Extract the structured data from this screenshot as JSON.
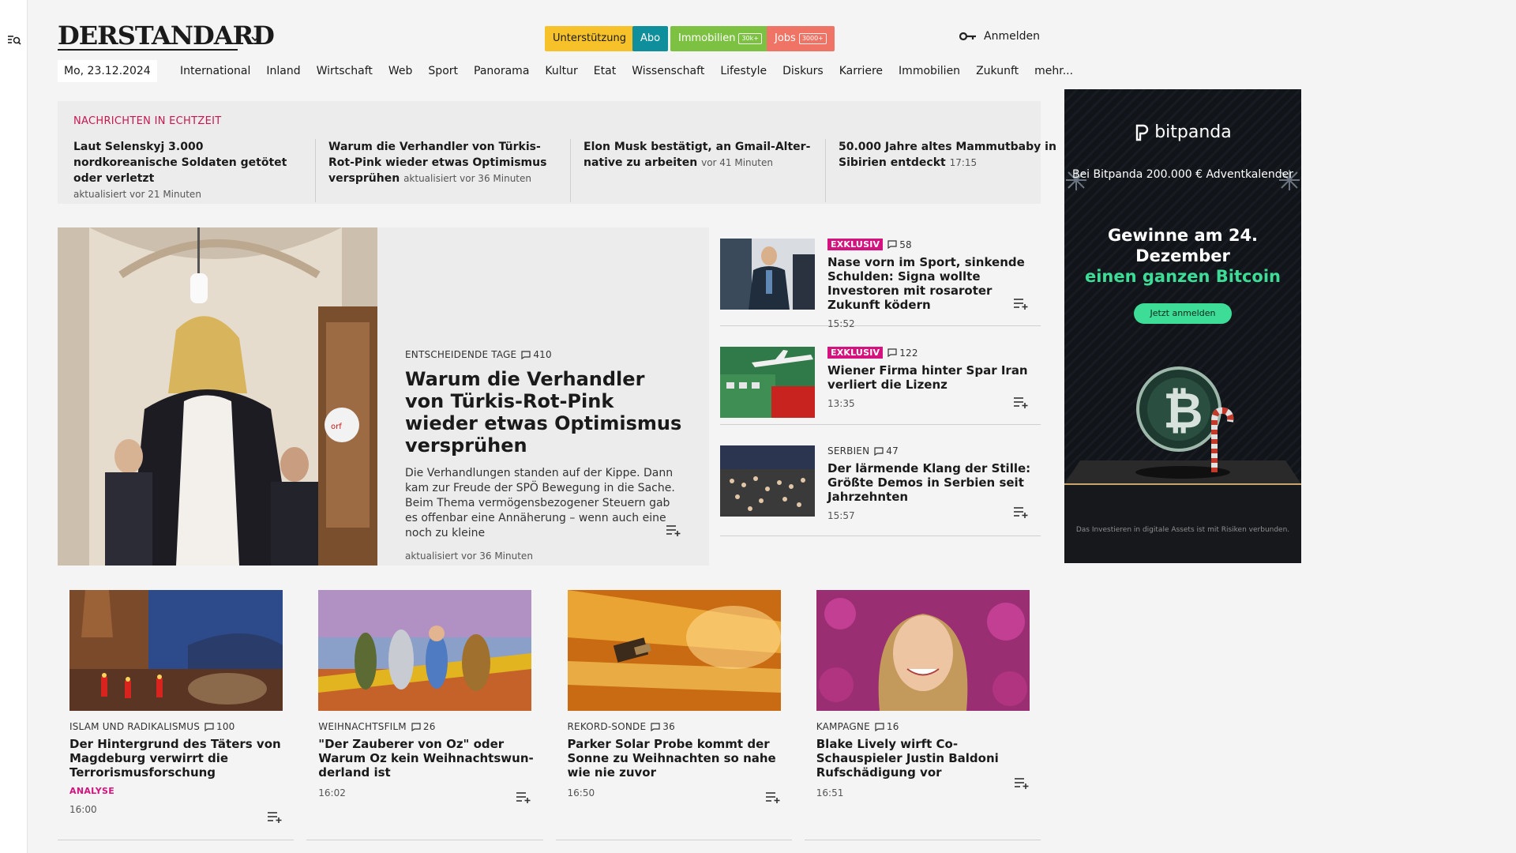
{
  "brand": {
    "logo": "DERSTANDARD"
  },
  "topbar": {
    "pills": [
      {
        "label": "Unterstützung",
        "badge": "",
        "bg": "#f7c229",
        "fg": "#1a1a1a"
      },
      {
        "label": "Abo",
        "badge": "",
        "bg": "#0e8f9b",
        "fg": "#ffffff"
      },
      {
        "label": "Immobilien",
        "badge": "30k+",
        "bg": "#7dc142",
        "fg": "#ffffff"
      },
      {
        "label": "Jobs",
        "badge": "3000+",
        "bg": "#ef7466",
        "fg": "#ffffff"
      }
    ],
    "login": "Anmelden"
  },
  "nav": {
    "date": "Mo, 23.12.2024",
    "items": [
      "International",
      "Inland",
      "Wirtschaft",
      "Web",
      "Sport",
      "Panorama",
      "Kultur",
      "Etat",
      "Wissenschaft",
      "Lifestyle",
      "Diskurs",
      "Karriere",
      "Immobilien",
      "Zukunft",
      "mehr..."
    ]
  },
  "ticker": {
    "label": "NACHRICHTEN IN ECHTZEIT",
    "items": [
      {
        "title": "Laut Selenskyj 3.000 nordkoreanische Soldaten getötet oder verletzt",
        "meta": "aktualisiert vor 21 Minuten"
      },
      {
        "title": "Warum die Verhandler von Türkis-Rot-Pink wieder etwas Optimismus versprühen",
        "meta": "aktualisiert vor 36 Minuten"
      },
      {
        "title": "Elon Musk bestätigt, an Gmail-Alter­native zu arbeiten",
        "meta": "vor 41 Minuten"
      },
      {
        "title": "50.000 Jahre altes Mammutbaby in Sibirien entdeckt",
        "meta": "17:15"
      }
    ]
  },
  "hero": {
    "kicker": "ENTSCHEIDENDE TAGE",
    "comments": "410",
    "title": "Warum die Verhandler von Türkis-Rot-Pink wieder etwas Optimismus versprühen",
    "lead": "Die Verhandlungen standen auf der Kippe. Dann kam zur Freude der SPÖ Bewegung in die Sache. Beim Thema vermögensbezogener Steuern gab es offenbar eine Annäherung – wenn auch eine noch zu kleine",
    "time": "aktualisiert vor 36 Minuten"
  },
  "side": [
    {
      "badge": "EXKLUSIV",
      "kicker": "",
      "comments": "58",
      "title": "Nase vorn im Sport, sinkende Schulden: Signa wollte Investoren mit rosaroter Zukunft ködern",
      "time": "15:52"
    },
    {
      "badge": "EXKLUSIV",
      "kicker": "",
      "comments": "122",
      "title": "Wiener Firma hinter Spar Iran verliert die Lizenz",
      "time": "13:35"
    },
    {
      "badge": "",
      "kicker": "SERBIEN",
      "comments": "47",
      "title": "Der lärmende Klang der Stille: Größte Demos in Serbien seit Jahrzehnten",
      "time": "15:57"
    }
  ],
  "cards": [
    {
      "kicker": "ISLAM UND RADIKALISMUS",
      "comments": "100",
      "title": "Der Hintergrund des Täters von Magdeburg verwirrt die Terroris­musforschung",
      "tag": "ANALYSE",
      "time": "16:00"
    },
    {
      "kicker": "WEIHNACHTSFILM",
      "comments": "26",
      "title": "\"Der Zauberer von Oz\" oder Warum Oz kein Weihnachtswun­derland ist",
      "tag": "",
      "time": "16:02"
    },
    {
      "kicker": "REKORD-SONDE",
      "comments": "36",
      "title": "Parker Solar Probe kommt der Sonne zu Weihnachten so nahe wie nie zuvor",
      "tag": "",
      "time": "16:50"
    },
    {
      "kicker": "KAMPAGNE",
      "comments": "16",
      "title": "Blake Lively wirft Co-Schauspieler Justin Baldoni Rufschädigung vor",
      "tag": "",
      "time": "16:51"
    }
  ],
  "ad": {
    "brand": "bitpanda",
    "strip": "Bei Bitpanda 200.000 € Adventkalender",
    "headline1": "Gewinne am 24.",
    "headline2": "Dezember",
    "headline3": "einen ganzen Bitcoin",
    "button": "Jetzt anmelden",
    "disclaimer": "Das Investieren in digitale Assets ist mit Risiken verbunden."
  }
}
